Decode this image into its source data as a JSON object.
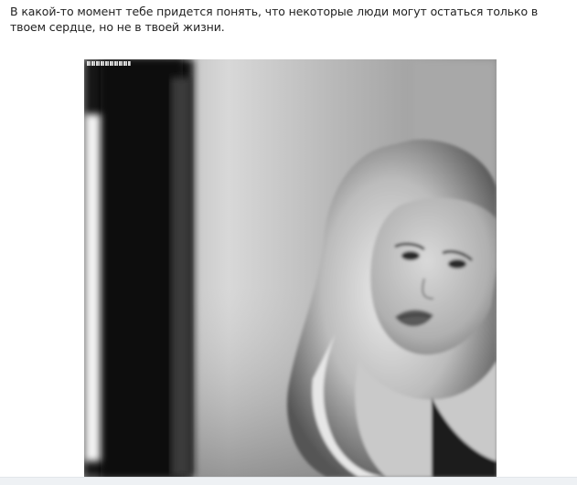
{
  "post": {
    "text": "В какой-то момент тебе придется понять, что некоторые люди могут остаться только в твоем сердце, но не в твоей жизни."
  },
  "photo": {
    "style": "black-and-white portrait"
  }
}
